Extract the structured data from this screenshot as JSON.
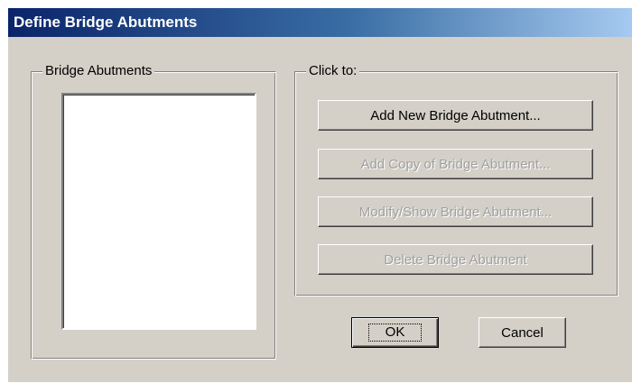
{
  "window": {
    "title": "Define Bridge Abutments"
  },
  "abutments_group": {
    "label": "Bridge Abutments",
    "items": []
  },
  "actions_group": {
    "label": "Click to:",
    "add_new_label": "Add New Bridge Abutment...",
    "add_copy_label": "Add Copy of Bridge Abutment...",
    "modify_label": "Modify/Show Bridge Abutment...",
    "delete_label": "Delete Bridge Abutment"
  },
  "footer": {
    "ok_label": "OK",
    "cancel_label": "Cancel"
  },
  "colors": {
    "dialog_face": "#d4d0c8",
    "title_gradient_start": "#0a246a",
    "title_gradient_end": "#a6caf0",
    "disabled_text": "#a0a0a0"
  }
}
